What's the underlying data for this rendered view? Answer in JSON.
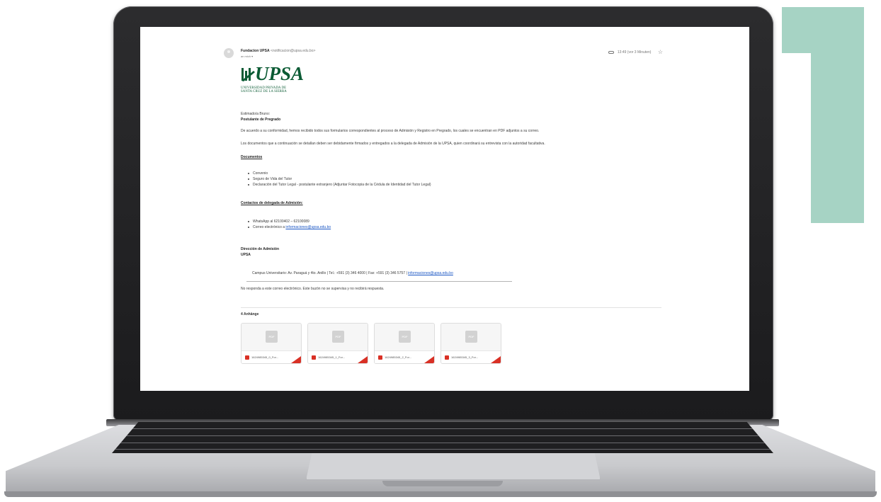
{
  "colors": {
    "brand_green": "#0b5b34",
    "teal_accent": "#a6d3c4",
    "link_blue": "#1a56c4",
    "pdf_red": "#d93025"
  },
  "email": {
    "sender_name": "Fundacion UPSA",
    "sender_address": "<notificacion@upsa.edu.bo>",
    "recipient": "an mich ▾",
    "time": "13:49 (vor 3 Minuten)",
    "icons": {
      "attachment": "paperclip-icon",
      "star": "star-icon",
      "avatar": "person-avatar-icon"
    },
    "logo": {
      "word": "UPSA",
      "line1": "UNIVERSIDAD PRIVADA DE",
      "line2": "SANTA CRUZ DE LA SIERRA"
    },
    "greeting": "Estimado/a Bruno:",
    "role": "Postulante de Pregrado",
    "paragraph1": "De acuerdo a su conformidad, hemos recibido todos sus formularios correspondientes al proceso de Admisión y Registro en Pregrado, los cuales se encuentran en PDF adjuntos a su correo.",
    "paragraph2": "Los documentos que a continuación se detallan deben ser debidamente firmados y entregados a la delegada de Admisión de la UPSA, quien coordinará su entrevista con la autoridad facultativa.",
    "documents_heading": "Documentos",
    "documents": [
      "Convenio",
      "Seguro de Vida del Tutor",
      "Declaración del Tutor Legal - postulante extranjero (Adjuntar Fotocopia de la Cédula de Identidad del Tutor Legal)"
    ],
    "contacts_heading": "Contactos de delegada de Admisión:",
    "contact_whatsapp": "WhatsApp al 62100402 – 62100089",
    "contact_email_prefix": "Correo electrónico a ",
    "contact_email_link": "informaciones@upsa.edu.bo",
    "signature_line1": "Dirección de Admisión",
    "signature_line2": "UPSA",
    "footer_address": "Campus Universitario: Av. Paraguá y 4to. Anillo | Tel.: +591 (3) 346 4000 | Fax: +591 (3) 346 5757 | ",
    "footer_link": "informaciones@upsa.edu.bo",
    "no_reply": "No responda a este correo electrónico. Este buzón no se supervisa y no recibirá respuesta.",
    "attachments_title": "4 Anhänge",
    "attachments": [
      {
        "name": "1624985345_0_For...",
        "thumb": "PDF"
      },
      {
        "name": "1624985345_1_For...",
        "thumb": "PDF"
      },
      {
        "name": "1624985345_2_For...",
        "thumb": "PDF"
      },
      {
        "name": "1624985345_3_For...",
        "thumb": "PDF"
      }
    ]
  }
}
